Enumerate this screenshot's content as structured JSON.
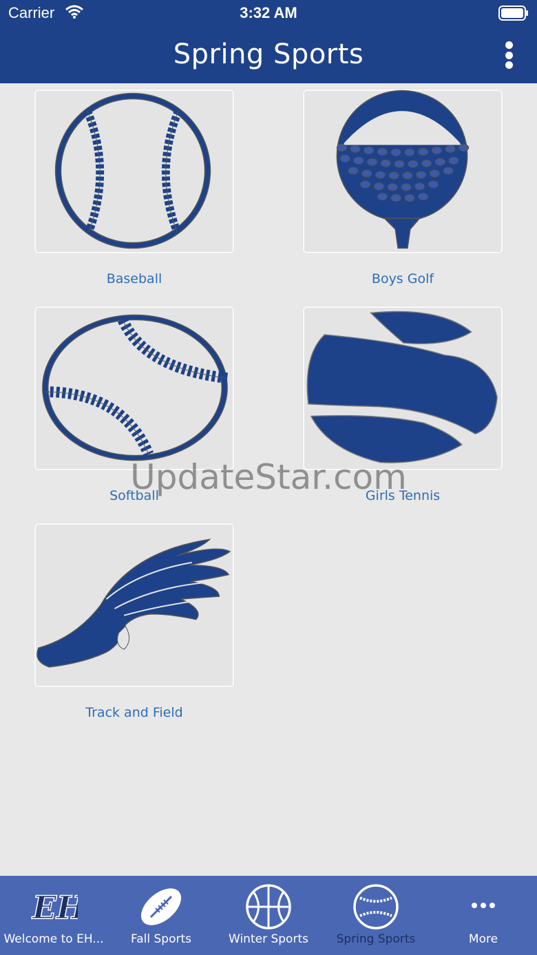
{
  "status_bar": {
    "carrier": "Carrier",
    "time": "3:32 AM"
  },
  "header": {
    "title": "Spring Sports"
  },
  "sports": [
    {
      "label": "Baseball",
      "icon": "baseball-icon"
    },
    {
      "label": "Boys Golf",
      "icon": "golf-ball-icon"
    },
    {
      "label": "Softball",
      "icon": "softball-icon"
    },
    {
      "label": "Girls Tennis",
      "icon": "tennis-ball-icon"
    },
    {
      "label": "Track and Field",
      "icon": "winged-shoe-icon"
    }
  ],
  "watermark": "UpdateStar.com",
  "tabs": [
    {
      "label": "Welcome to EH...",
      "icon": "eh-logo-icon",
      "active": false
    },
    {
      "label": "Fall Sports",
      "icon": "football-icon",
      "active": false
    },
    {
      "label": "Winter Sports",
      "icon": "basketball-icon",
      "active": false
    },
    {
      "label": "Spring Sports",
      "icon": "baseball-icon",
      "active": true
    },
    {
      "label": "More",
      "icon": "more-dots-icon",
      "active": false
    }
  ],
  "colors": {
    "primary": "#1e4289",
    "tab_bar": "#4a67b4",
    "icon_blue": "#1e4289",
    "label_blue": "#2e6cb4",
    "background": "#e8e8e8"
  }
}
